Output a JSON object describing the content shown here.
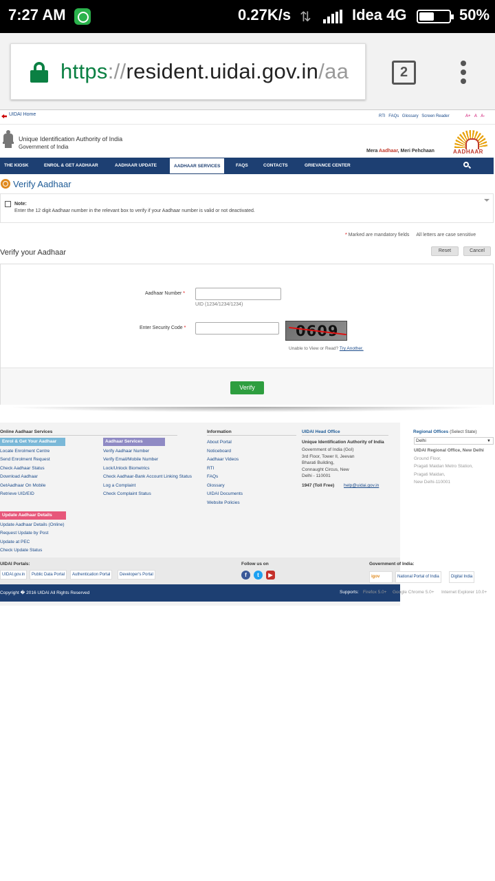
{
  "status_bar": {
    "time": "7:27 AM",
    "speed": "0.27K/s",
    "carrier": "Idea 4G",
    "battery": "50%",
    "battery_level": 0.5
  },
  "browser": {
    "url_scheme": "https",
    "url_sep": "://",
    "url_host": "resident.uidai.gov.in",
    "url_path": "/aa",
    "tab_count": "2"
  },
  "topbar": {
    "home": "UIDAI Home",
    "links": [
      "RTI",
      "FAQs",
      "Glossary",
      "Screen Reader"
    ],
    "font_sizes": [
      "A+",
      "A",
      "A-"
    ]
  },
  "header": {
    "org_name": "Unique Identification Authority of India",
    "org_sub": "Government of India",
    "tagline_pre": "Mera ",
    "tagline_red": "Aadhaar",
    "tagline_post": ", Meri Pehchaan",
    "logo_word": "AADHAAR"
  },
  "nav": {
    "items": [
      "THE KIOSK",
      "ENROL & GET AADHAAR",
      "AADHAAR UPDATE",
      "AADHAAR SERVICES",
      "FAQS",
      "CONTACTS",
      "GRIEVANCE CENTER"
    ]
  },
  "page": {
    "title": "Verify Aadhaar",
    "note_title": "Note:",
    "note_text": "Enter the 12 digit Aadhaar number in the relevant box to verify if your Aadhaar number is valid or not deactivated.",
    "mandatory_star": "*",
    "mandatory_text": " Marked are mandatory fields",
    "case_text": "All letters are case sensitive",
    "section_title": "Verify your Aadhaar",
    "reset": "Reset",
    "cancel": "Cancel"
  },
  "form": {
    "aadhaar_label": "Aadhaar Number",
    "aadhaar_value": "",
    "aadhaar_hint": "UID (1234/1234/1234)",
    "security_label": "Enter Security Code",
    "security_value": "",
    "star": "*",
    "captcha_code": "0609",
    "unable_text": "Unable to View or Read? ",
    "try_another": "Try Another.",
    "verify": "Verify"
  },
  "footer": {
    "online_services_title": "Online Aadhaar Services",
    "enrol_tag": "Enrol & Get Your Aadhaar",
    "enrol_links": [
      "Locate Enrolment Centre",
      "Send Enrolment Request",
      "Check Aadhaar Status",
      "Download Aadhaar",
      "GetAadhaar On Mobile",
      "Retrieve UID/EID"
    ],
    "services_tag": "Aadhaar Services",
    "services_links": [
      "Verify Aadhaar Number",
      "Verify Email/Mobile Number",
      "Lock/Unlock Biometrics",
      "Check Aadhaar-Bank Account Linking Status",
      "Log a Complaint",
      "Check Complaint Status"
    ],
    "update_tag": "Update Aadhaar Details",
    "update_links": [
      "Update Aadhaar Details (Online)",
      "Request Update by Post",
      "Update at PEC",
      "Check Update Status"
    ],
    "info_title": "Information",
    "info_links": [
      "About Portal",
      "Noticeboard",
      "Aadhaar Videos",
      "RTI",
      "FAQs",
      "Glossary",
      "UIDAI Documents",
      "Website Policies"
    ],
    "head_office_title": "UIDAI Head Office",
    "head_office_lines": [
      "Unique Identification Authority of India",
      "Government of India (GoI)",
      "3rd Floor, Tower II, Jeevan",
      "Bharati Building,",
      "Connaught Circus, New",
      "Delhi - 110001"
    ],
    "toll_free": "1947 (Toll Free)",
    "email": "help@uidai.gov.in",
    "regional_title": "Regional Offices",
    "regional_select_hint": " (Select State)",
    "regional_selected": "Delhi",
    "regional_office_title": "UIDAI Regional Office, New Delhi",
    "regional_lines": [
      "Ground Floor,",
      "Pragati Maidan Metro Station,",
      "Pragati Maidan,",
      "New Delhi-110001"
    ],
    "portals_title": "UIDAI Portals:",
    "portals": [
      "UIDAI.gov.in",
      "Public Data Portal",
      "Authentication Portal",
      "Developer's Portal"
    ],
    "follow_title": "Follow us on",
    "gov_title": "Government of India:",
    "gov_links": [
      "igov",
      "National Portal of India",
      "Digital India"
    ],
    "copyright": "Copyright � 2016 UIDAI All Rights Reserved",
    "supports_label": "Supports:",
    "supports": [
      "Firefox 5.0+",
      "Google Chrome 5.0+",
      "Internet Explorer 10.0+"
    ]
  }
}
